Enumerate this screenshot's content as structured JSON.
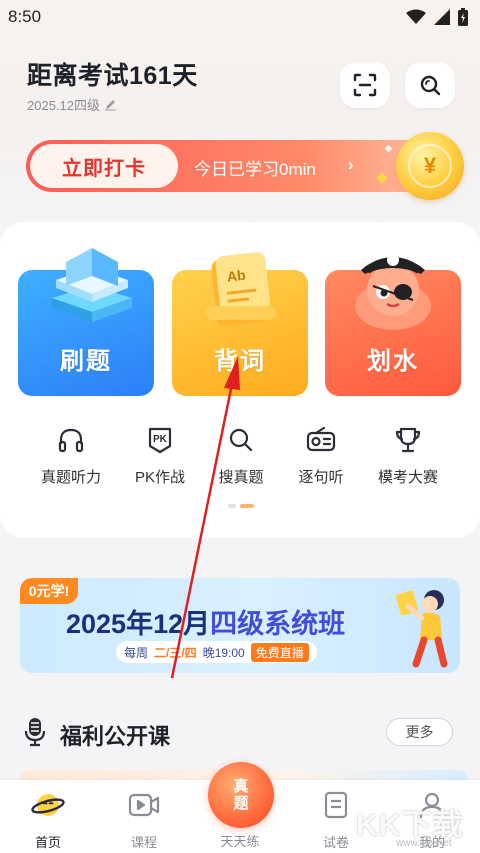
{
  "status_bar": {
    "time": "8:50"
  },
  "header": {
    "countdown": "距离考试161天",
    "exam": "2025.12四级"
  },
  "checkin": {
    "button_label": "立即打卡",
    "study_text": "今日已学习0min",
    "arrow": "›"
  },
  "features": [
    {
      "label": "刷题"
    },
    {
      "label": "背词"
    },
    {
      "label": "划水"
    }
  ],
  "quick_actions": [
    {
      "label": "真题听力",
      "icon": "headphones-icon"
    },
    {
      "label": "PK作战",
      "icon": "pk-icon"
    },
    {
      "label": "搜真题",
      "icon": "search-icon"
    },
    {
      "label": "逐句听",
      "icon": "radio-icon"
    },
    {
      "label": "模考大赛",
      "icon": "trophy-icon"
    }
  ],
  "promo": {
    "tag": "0元学!",
    "title_part1": "2025年12月",
    "title_highlight": "四级系统班",
    "schedule_prefix": "每周",
    "schedule_days": "二/三/四",
    "schedule_time": "晚19:00",
    "schedule_free": "免费直播"
  },
  "section": {
    "title": "福利公开课",
    "more_label": "更多"
  },
  "tabbar": {
    "items": [
      {
        "label": "首页",
        "active": true
      },
      {
        "label": "课程",
        "active": false
      },
      {
        "label": "天天练",
        "active": false
      },
      {
        "label": "试卷",
        "active": false
      },
      {
        "label": "我的",
        "active": false
      }
    ],
    "center_text": "真题"
  },
  "watermark": {
    "text": "KK下载",
    "url": "www.kkx.net"
  },
  "colors": {
    "accent_red": "#e8332c",
    "arrow_red": "#e02020",
    "orange": "#ff8a1f",
    "navy": "#1b2f7a"
  }
}
